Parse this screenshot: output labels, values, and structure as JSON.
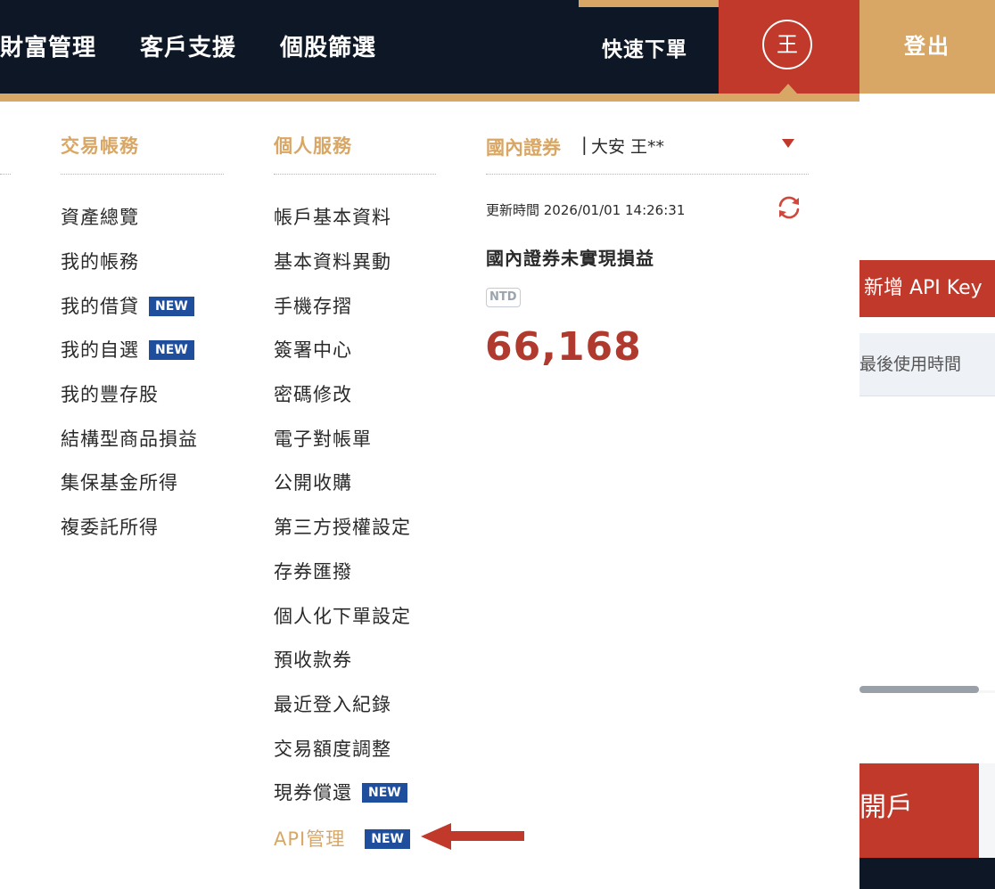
{
  "nav": {
    "items": [
      "財富管理",
      "客戶支援",
      "個股篩選"
    ],
    "quick_order": "快速下單",
    "avatar_initial": "王",
    "logout": "登出"
  },
  "background_page": {
    "add_api_key": "新增 API Key",
    "last_used_header": "最後使用時間",
    "open_account_fragment": "開戶"
  },
  "menu": {
    "trading": {
      "title": "交易帳務",
      "items": [
        "資產總覽",
        "我的帳務",
        "我的借貸",
        "我的自選",
        "我的豐存股",
        "結構型商品損益",
        "集保基金所得",
        "複委託所得"
      ]
    },
    "personal": {
      "title": "個人服務",
      "items": [
        "帳戶基本資料",
        "基本資料異動",
        "手機存摺",
        "簽署中心",
        "密碼修改",
        "電子對帳單",
        "公開收購",
        "第三方授權設定",
        "存券匯撥",
        "個人化下單設定",
        "預收款券",
        "最近登入紀錄",
        "交易額度調整",
        "現券償還",
        "API管理"
      ]
    },
    "badge_new": "NEW"
  },
  "account": {
    "label": "國內證券",
    "separator": "|",
    "name": "大安 王**",
    "update_label": "更新時間 2026/01/01 14:26:31",
    "pl_title": "國內證券未實現損益",
    "currency": "NTD",
    "pl_value": "66,168"
  },
  "colors": {
    "navy": "#0e1726",
    "gold": "#d9a765",
    "red": "#c0392b",
    "badge_blue": "#1f4e9c",
    "value_red": "#b03a2e"
  }
}
